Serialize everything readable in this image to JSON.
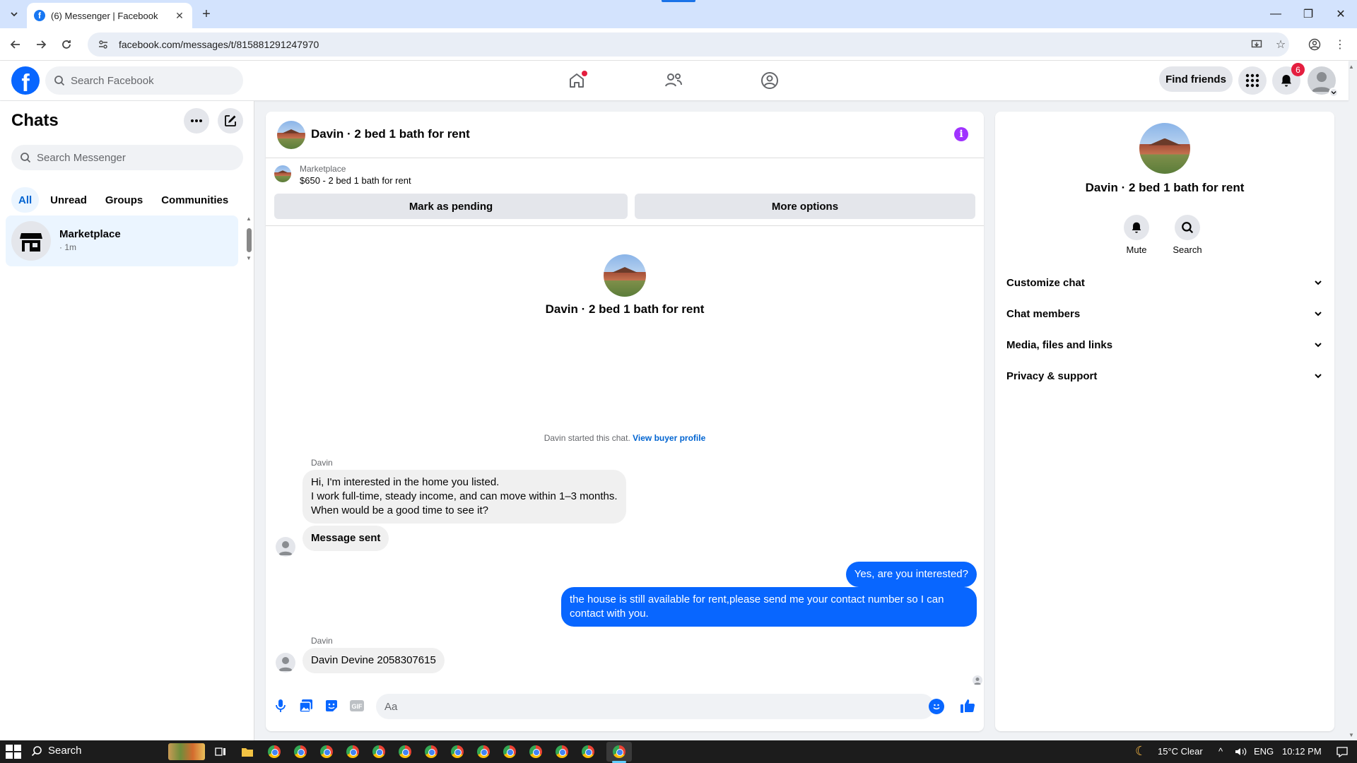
{
  "browser": {
    "tab_title": "(6) Messenger | Facebook",
    "url": "facebook.com/messages/t/815881291247970"
  },
  "fb": {
    "search_placeholder": "Search Facebook",
    "find_friends": "Find friends",
    "notification_count": "6",
    "brand_color": "#0866ff"
  },
  "sidebar": {
    "title": "Chats",
    "search_placeholder": "Search Messenger",
    "tabs": [
      "All",
      "Unread",
      "Groups",
      "Communities"
    ],
    "chat": {
      "name": "Marketplace",
      "time": "· 1m"
    }
  },
  "conversation": {
    "title": "Davin · 2 bed 1 bath for rent",
    "marketplace_label": "Marketplace",
    "listing": "$650 - 2 bed 1 bath for rent",
    "mark_pending": "Mark as pending",
    "more_options": "More options",
    "intro_name": "Davin · 2 bed 1 bath for rent",
    "started_text": "Davin started this chat.",
    "view_buyer_profile": "View buyer profile",
    "sender1": "Davin",
    "msg1_line1": "Hi, I'm interested in the home you listed.",
    "msg1_line2": "I work full-time, steady income, and can move within 1–3 months.",
    "msg1_line3": "When would be a good time to see it?",
    "msg2": "Message sent",
    "out1": "Yes, are you interested?",
    "out2_line1": "the house is still available for rent,please send me your contact number so I can",
    "out2_line2": "contact with you.",
    "sender2": "Davin",
    "msg3": "Davin Devine 2058307615",
    "composer_placeholder": "Aa"
  },
  "rpanel": {
    "name": "Davin · 2 bed 1 bath for rent",
    "mute": "Mute",
    "search": "Search",
    "rows": [
      "Customize chat",
      "Chat members",
      "Media, files and links",
      "Privacy & support"
    ]
  },
  "taskbar": {
    "search": "Search",
    "weather": "15°C Clear",
    "lang": "ENG",
    "time": "10:12 PM"
  }
}
